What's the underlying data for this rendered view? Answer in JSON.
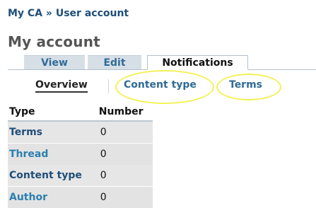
{
  "breadcrumb": {
    "root": "My CA",
    "separator": "»",
    "current": "User account"
  },
  "page_title": "My account",
  "tabs": [
    {
      "label": "View",
      "active": false
    },
    {
      "label": "Edit",
      "active": false
    },
    {
      "label": "Notifications",
      "active": true
    }
  ],
  "subtabs": [
    {
      "label": "Overview",
      "active": true
    },
    {
      "label": "Content type",
      "active": false
    },
    {
      "label": "Terms",
      "active": false
    }
  ],
  "table": {
    "columns": [
      "Type",
      "Number"
    ],
    "rows": [
      {
        "type": "Terms",
        "number": "0"
      },
      {
        "type": "Thread",
        "number": "0"
      },
      {
        "type": "Content type",
        "number": "0"
      },
      {
        "type": "Author",
        "number": "0"
      }
    ]
  },
  "colors": {
    "link": "#1f4e79",
    "highlight": "#f3f155",
    "tab_inactive_bg": "#d7dfe6"
  }
}
